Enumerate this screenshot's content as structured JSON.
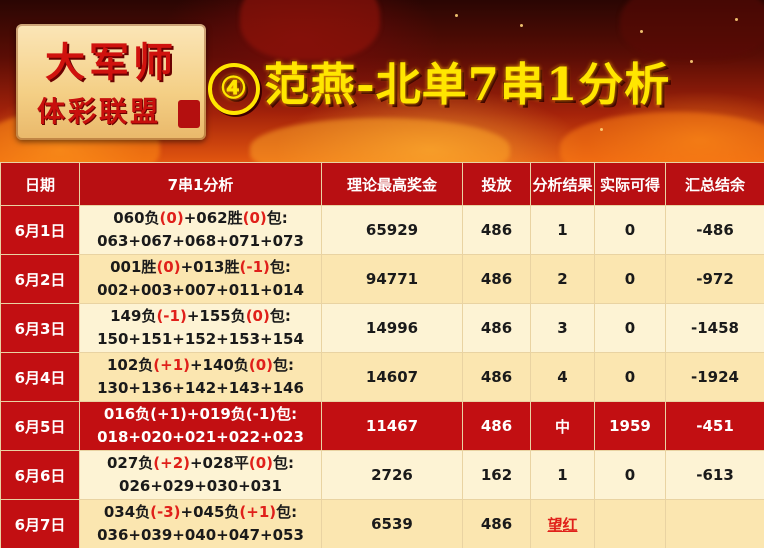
{
  "banner": {
    "logo_line1": "大军师",
    "logo_line2": "体彩联盟",
    "title_num": "④",
    "title_text": "范燕-北单7串1分析"
  },
  "headers": [
    "日期",
    "7串1分析",
    "理论最高奖金",
    "投放",
    "分析结果",
    "实际可得",
    "汇总结余"
  ],
  "rows": [
    {
      "date": "6月1日",
      "a_code": "060负",
      "a_h": "(0)",
      "b_code": "+062胜",
      "b_h": "(0)",
      "tail": "包:",
      "combo": "063+067+068+071+073",
      "bonus": "65929",
      "stake": "486",
      "result": "1",
      "actual": "0",
      "balance": "-486"
    },
    {
      "date": "6月2日",
      "a_code": "001胜",
      "a_h": "(0)",
      "b_code": "+013胜",
      "b_h": "(-1)",
      "tail": "包:",
      "combo": "002+003+007+011+014",
      "bonus": "94771",
      "stake": "486",
      "result": "2",
      "actual": "0",
      "balance": "-972"
    },
    {
      "date": "6月3日",
      "a_code": "149负",
      "a_h": "(-1)",
      "b_code": "+155负",
      "b_h": "(0)",
      "tail": "包:",
      "combo": "150+151+152+153+154",
      "bonus": "14996",
      "stake": "486",
      "result": "3",
      "actual": "0",
      "balance": "-1458"
    },
    {
      "date": "6月4日",
      "a_code": "102负",
      "a_h": "(+1)",
      "b_code": "+140负",
      "b_h": "(0)",
      "tail": "包:",
      "combo": "130+136+142+143+146",
      "bonus": "14607",
      "stake": "486",
      "result": "4",
      "actual": "0",
      "balance": "-1924"
    },
    {
      "date": "6月5日",
      "a_code": "016负",
      "a_h": "(+1)",
      "b_code": "+019负",
      "b_h": "(-1)",
      "tail": "包:",
      "combo": "018+020+021+022+023",
      "bonus": "11467",
      "stake": "486",
      "result": "中",
      "actual": "1959",
      "balance": "-451"
    },
    {
      "date": "6月6日",
      "a_code": "027负",
      "a_h": "(+2)",
      "b_code": "+028平",
      "b_h": "(0)",
      "tail": "包:",
      "combo": "026+029+030+031",
      "bonus": "2726",
      "stake": "162",
      "result": "1",
      "actual": "0",
      "balance": "-613"
    },
    {
      "date": "6月7日",
      "a_code": "034负",
      "a_h": "(-3)",
      "b_code": "+045负",
      "b_h": "(+1)",
      "tail": "包:",
      "combo": "036+039+040+047+053",
      "bonus": "6539",
      "stake": "486",
      "result": "望红",
      "actual": "",
      "balance": ""
    }
  ]
}
